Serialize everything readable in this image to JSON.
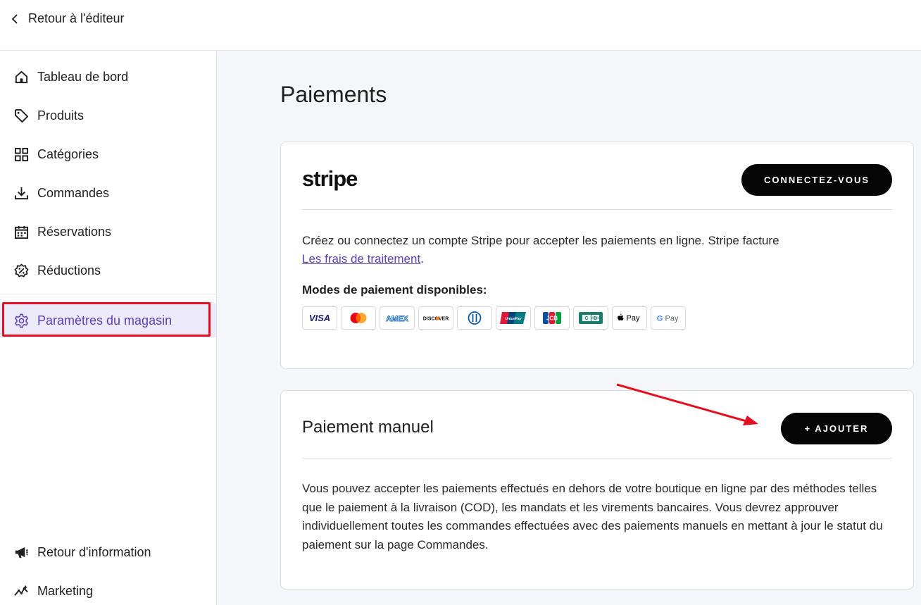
{
  "topbar": {
    "back_label": "Retour à l'éditeur"
  },
  "sidebar": {
    "items": [
      {
        "label": "Tableau de bord",
        "icon": "home-icon"
      },
      {
        "label": "Produits",
        "icon": "tag-icon"
      },
      {
        "label": "Catégories",
        "icon": "grid-icon"
      },
      {
        "label": "Commandes",
        "icon": "download-icon"
      },
      {
        "label": "Réservations",
        "icon": "calendar-icon"
      },
      {
        "label": "Réductions",
        "icon": "discount-badge-icon"
      },
      {
        "label": "Paramètres du magasin",
        "icon": "gear-icon",
        "active": true
      },
      {
        "label": "Retour d'information",
        "icon": "megaphone-icon"
      },
      {
        "label": "Marketing",
        "icon": "sparkline-icon"
      }
    ]
  },
  "main": {
    "title": "Paiements",
    "stripe": {
      "logo": "stripe",
      "connect_label": "CONNECTEZ-VOUS",
      "description": "Créez ou connectez un compte Stripe pour accepter les paiements en ligne. Stripe facture",
      "fees_link": "Les frais de traitement",
      "fees_suffix": ".",
      "methods_title": "Modes de paiement disponibles:",
      "methods": [
        "VISA",
        "Mastercard",
        "AMEX",
        "DISCOVER",
        "Diners Club",
        "UnionPay",
        "JCB",
        "CB",
        "Apple Pay",
        "G Pay"
      ]
    },
    "manual": {
      "title": "Paiement manuel",
      "add_label": "+ AJOUTER",
      "description": "Vous pouvez accepter les paiements effectués en dehors de votre boutique en ligne par des méthodes telles que le paiement à la livraison (COD), les mandats et les virements bancaires. Vous devrez approuver individuellement toutes les commandes effectuées avec des paiements manuels en mettant à jour le statut du paiement sur la page Commandes."
    }
  },
  "colors": {
    "accent": "#5b3fb6",
    "highlight_border": "#e5101f",
    "annotation_arrow": "#e5101f",
    "button_bg": "#050505",
    "main_bg": "#f4f6f9"
  }
}
